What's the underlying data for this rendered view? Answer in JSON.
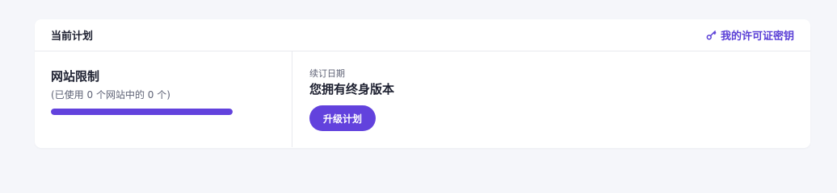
{
  "plan_card": {
    "title": "当前计划",
    "license_link": {
      "label": "我的许可证密钥",
      "icon": "key-icon"
    }
  },
  "website_limit": {
    "title": "网站限制",
    "usage_text": "(已使用 0 个网站中的 0 个)",
    "progress_percent": 100
  },
  "renewal": {
    "label": "续订日期",
    "value": "您拥有终身版本"
  },
  "upgrade_button": {
    "label": "升级计划"
  },
  "colors": {
    "accent": "#6242dd",
    "page_background": "#f5f6fa",
    "card_background": "#ffffff",
    "text_primary": "#1d2030",
    "text_secondary": "#5e6275"
  }
}
